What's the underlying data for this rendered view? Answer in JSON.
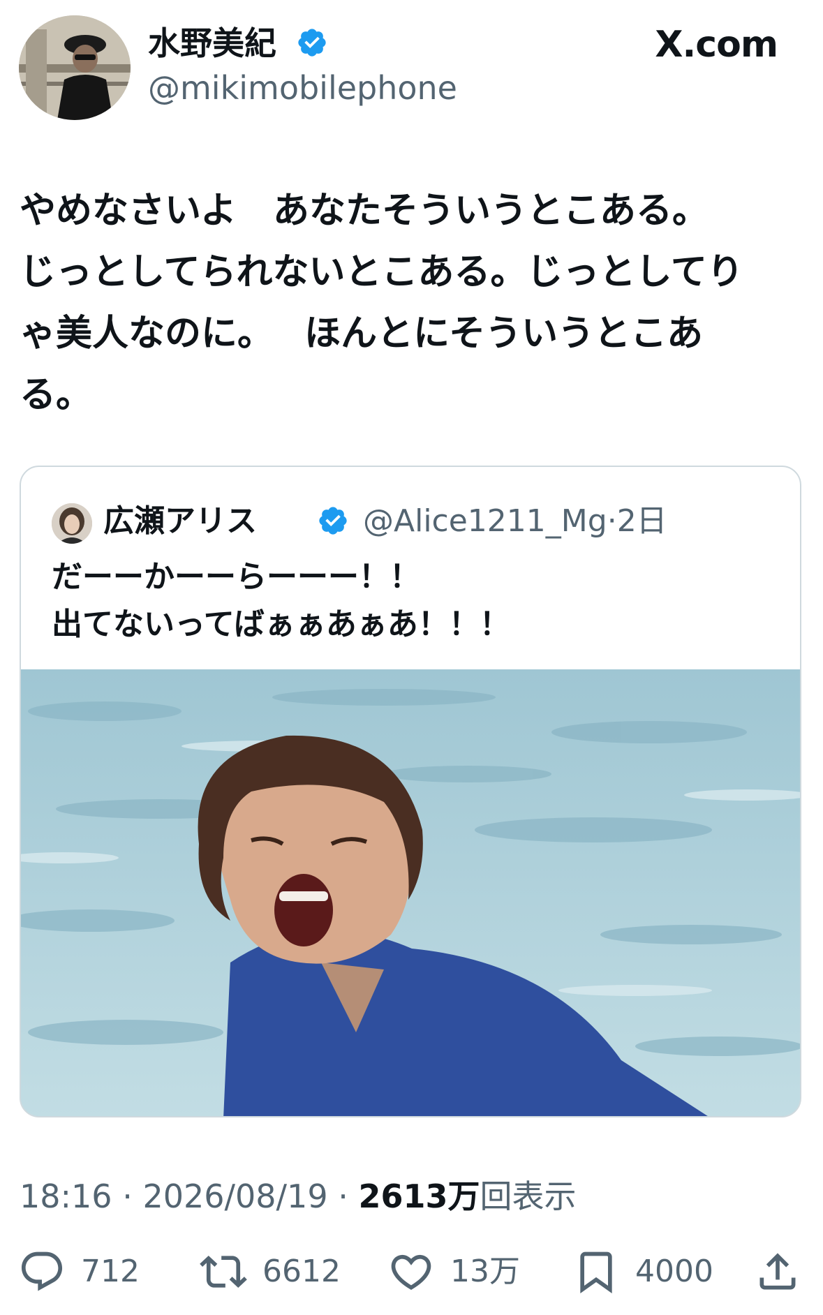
{
  "author": {
    "display_name": "水野美紀",
    "handle": "@mikimobilephone",
    "verified": true
  },
  "site_label": "X.com",
  "tweet": {
    "text": "やめなさいよ　あなたそういうとこある。\nじっとしてられないとこある。じっとしてり\nゃ美人なのに。　 ほんとにそういうとこあ\nる。"
  },
  "quoted_tweet": {
    "display_name": "広瀬アリス",
    "handle": "@Alice1211_Mg",
    "separator": "·",
    "time": "2日",
    "verified": true,
    "text": "だーーかーーらーーー！！\n出てないってばぁぁあぁあ！！！"
  },
  "meta": {
    "time": "18:16",
    "date": "2026/08/19",
    "separator": "·",
    "views_count": "2613万",
    "views_label": "回表示"
  },
  "actions": {
    "replies": "712",
    "retweets": "6612",
    "likes": "13万",
    "bookmarks": "4000"
  },
  "colors": {
    "verified": "#1d9bf0",
    "secondary_text": "#536471",
    "border": "#cfd9de"
  }
}
